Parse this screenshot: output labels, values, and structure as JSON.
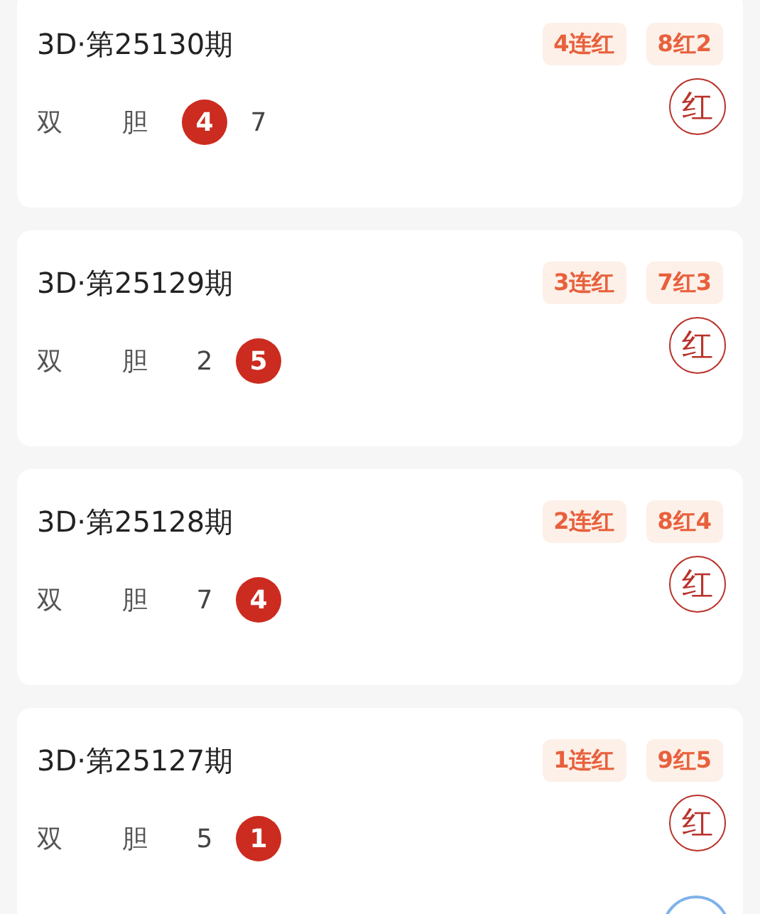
{
  "cards": [
    {
      "title": "3D·第25130期",
      "badges": [
        "4连红",
        "8红2"
      ],
      "labels": [
        "双",
        "胆"
      ],
      "numbers": [
        {
          "value": "4",
          "highlighted": true
        },
        {
          "value": "7",
          "highlighted": false
        }
      ],
      "result": "红"
    },
    {
      "title": "3D·第25129期",
      "badges": [
        "3连红",
        "7红3"
      ],
      "labels": [
        "双",
        "胆"
      ],
      "numbers": [
        {
          "value": "2",
          "highlighted": false
        },
        {
          "value": "5",
          "highlighted": true
        }
      ],
      "result": "红"
    },
    {
      "title": "3D·第25128期",
      "badges": [
        "2连红",
        "8红4"
      ],
      "labels": [
        "双",
        "胆"
      ],
      "numbers": [
        {
          "value": "7",
          "highlighted": false
        },
        {
          "value": "4",
          "highlighted": true
        }
      ],
      "result": "红"
    },
    {
      "title": "3D·第25127期",
      "badges": [
        "1连红",
        "9红5"
      ],
      "labels": [
        "双",
        "胆"
      ],
      "numbers": [
        {
          "value": "5",
          "highlighted": false
        },
        {
          "value": "1",
          "highlighted": true
        }
      ],
      "result": "红"
    }
  ]
}
